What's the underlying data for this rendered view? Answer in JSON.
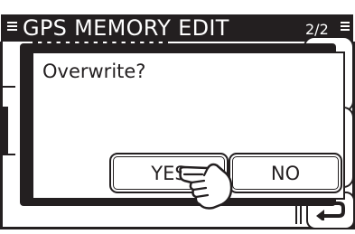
{
  "header": {
    "title": "GPS MEMORY EDIT",
    "page_indicator": "2/2",
    "menu_icon": "menu-lines-icon",
    "page_icon": "menu-lines-icon"
  },
  "dialog": {
    "message": "Overwrite?",
    "yes_label": "YES",
    "no_label": "NO"
  },
  "footer": {
    "back_icon": "return-arrow-icon"
  },
  "pointer": {
    "icon": "pointing-hand-icon"
  },
  "colors": {
    "foreground": "#231f20",
    "background": "#ffffff"
  }
}
